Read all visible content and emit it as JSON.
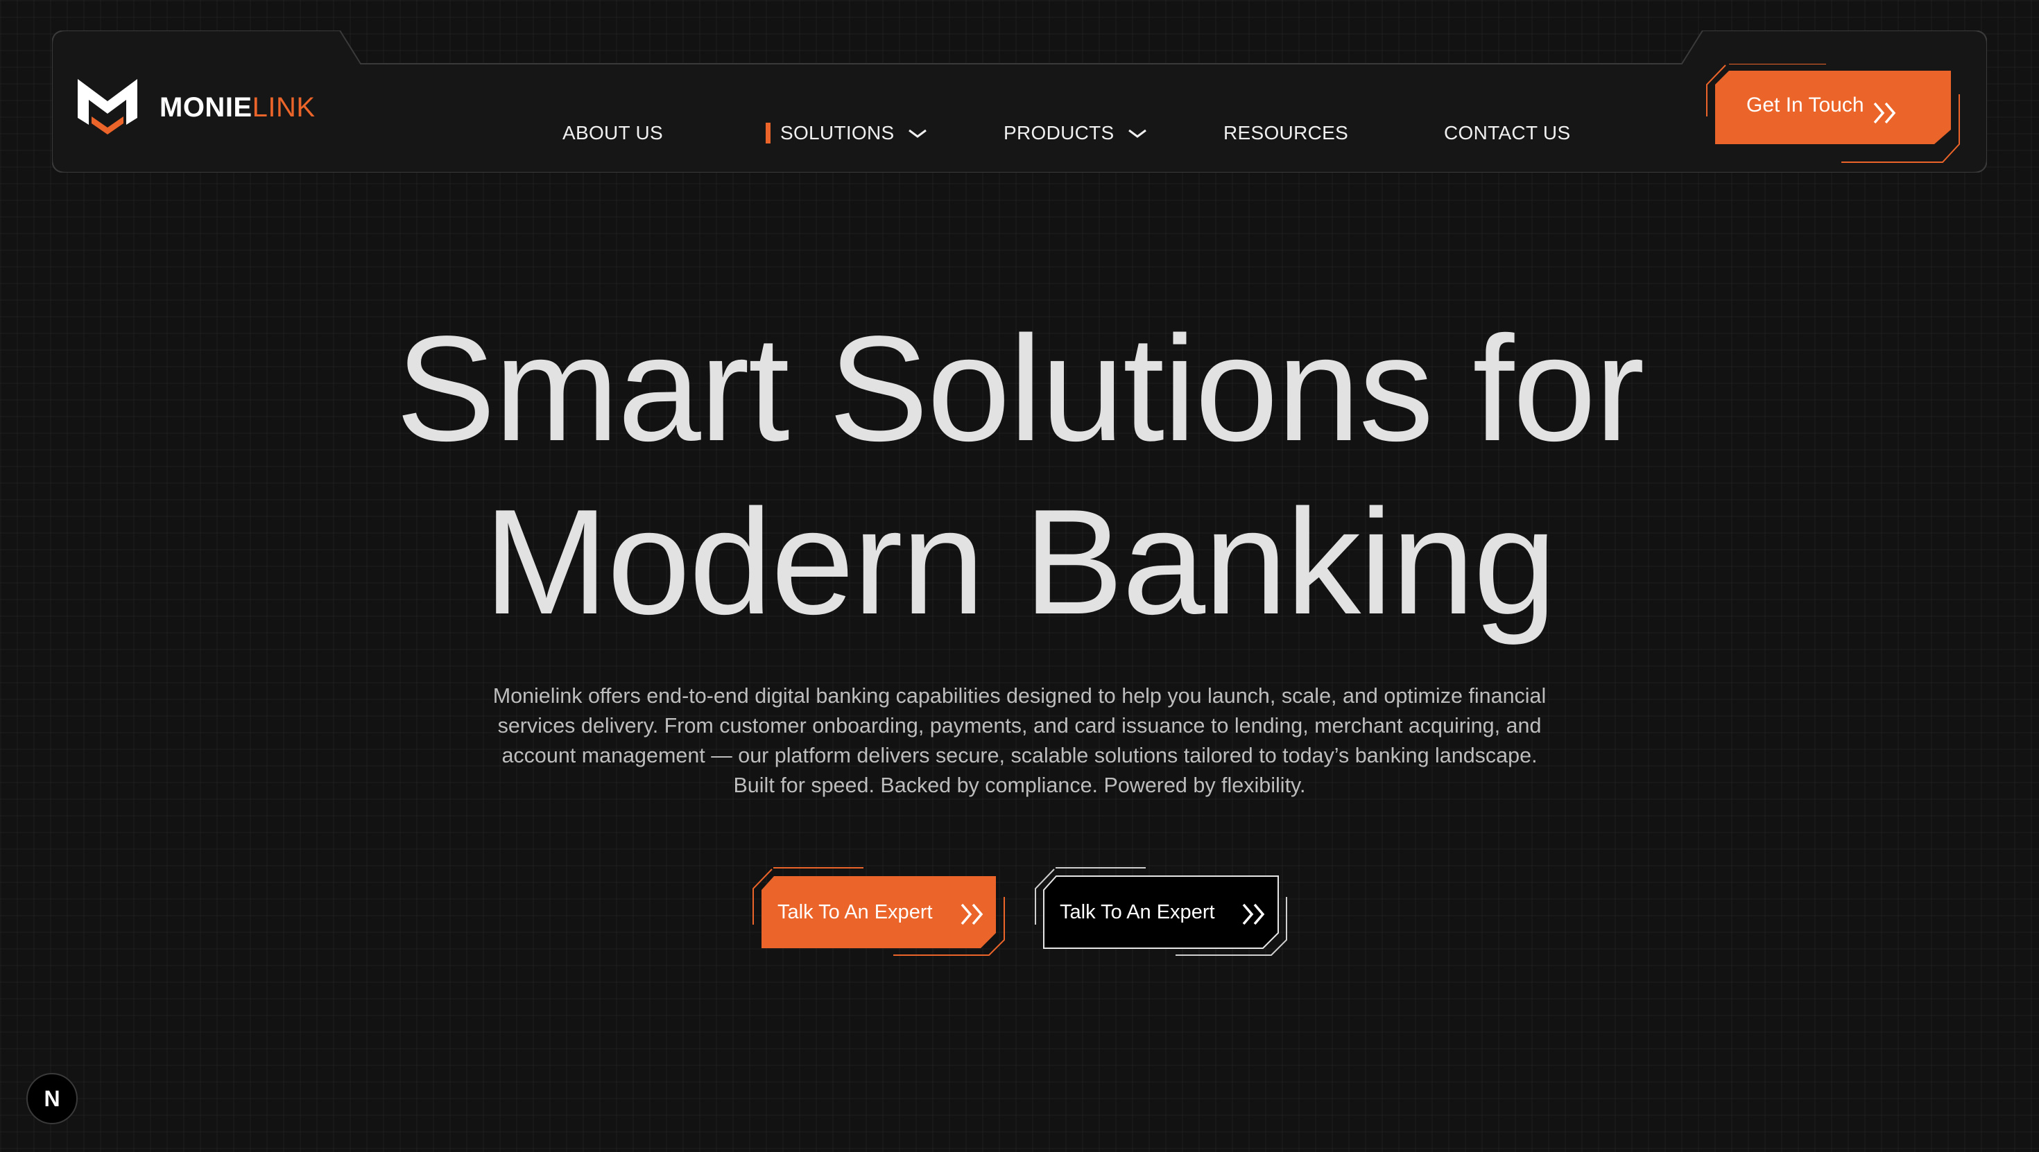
{
  "brand": {
    "name_primary": "MONIE",
    "name_accent": "LINK",
    "logo_icon": "m-shield-logo-icon",
    "accent_color": "#EB6429"
  },
  "nav": {
    "items": [
      {
        "label": "ABOUT US",
        "has_dropdown": false,
        "active": false
      },
      {
        "label": "SOLUTIONS",
        "has_dropdown": true,
        "active": true
      },
      {
        "label": "PRODUCTS",
        "has_dropdown": true,
        "active": false
      },
      {
        "label": "RESOURCES",
        "has_dropdown": false,
        "active": false
      },
      {
        "label": "CONTACT US",
        "has_dropdown": false,
        "active": false
      }
    ],
    "cta_label": "Get In Touch",
    "cta_icon": "double-chevron-right-icon"
  },
  "hero": {
    "headline_line1": "Smart Solutions for",
    "headline_line2": "Modern Banking",
    "description_lines": [
      "Monielink offers end-to-end digital banking capabilities designed to help you launch, scale, and optimize financial",
      "services delivery. From customer onboarding, payments, and card issuance to lending, merchant acquiring, and",
      "account management — our platform delivers secure, scalable solutions tailored to today’s banking landscape.",
      "Built for speed. Backed by compliance. Powered by flexibility."
    ],
    "primary_cta": "Talk To An Expert",
    "secondary_cta": "Talk To An Expert"
  },
  "dev_badge": {
    "label": "N",
    "icon": "nextjs-icon"
  },
  "colors": {
    "background": "#121212",
    "nav_background": "#161616",
    "headline": "#e2e2e2",
    "body_text": "#bdbdbd"
  }
}
